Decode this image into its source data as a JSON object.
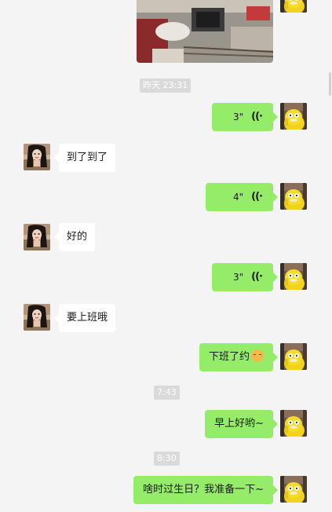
{
  "chat": {
    "timestamps": {
      "t1": "昨天 23:31",
      "t2": "7:43",
      "t3": "8:30"
    },
    "messages": {
      "m1": "3\"",
      "m2": "到了到了",
      "m3": "4\"",
      "m4": "好的",
      "m5": "3\"",
      "m6": "要上班哦",
      "m7": "下班了约",
      "m8": "早上好哟~",
      "m9": "啥时过生日？我准备一下~"
    },
    "voice_icon": "voice-wave-icon",
    "emoji": "blushing-face-emoji"
  },
  "colors": {
    "background": "#f4f4f4",
    "outgoing_bubble": "#95ec69",
    "incoming_bubble": "#ffffff",
    "timestamp_bg": "#dadada"
  }
}
